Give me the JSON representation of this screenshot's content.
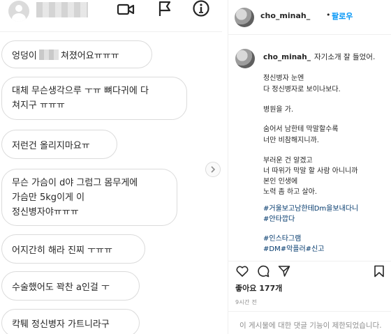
{
  "dm": {
    "header": {
      "icons": [
        "avatar",
        "video-call-icon",
        "flag-icon",
        "info-icon"
      ]
    },
    "messages": [
      {
        "parts": [
          "엉덩이",
          "쳐졌어요ㅠㅠㅠ"
        ]
      },
      {
        "lines": [
          "대체 무슨생각으루 ㅜㅠ 뼈다귀에 다",
          "쳐지구 ㅠㅠㅠ"
        ]
      },
      {
        "lines": [
          "저런건 올리지마요ㅠ"
        ]
      },
      {
        "lines": [
          "무슨 가슴이 d야 그럼그 몸무게에",
          "가슴만 5kg이게 이",
          "정신병자야ㅠㅠㅠ"
        ]
      },
      {
        "lines": [
          "어지간히 해라 진찌 ㅜㅠㅠ"
        ]
      },
      {
        "lines": [
          "수술했어도 꽉찬 a인걸 ㅜ"
        ]
      },
      {
        "lines": [
          "칵퉤 정신병자 가트니라구"
        ]
      }
    ]
  },
  "post": {
    "username": "cho_minah_",
    "follow_separator": "•",
    "follow_label": "팔로우",
    "caption_first": "자기소개 잘 들었어.",
    "caption_lines": [
      "정신병자 눈엔",
      "다 정신병자로 보이나보다.",
      "병원을 가.",
      "숨어서 남한테 막말할수록",
      "너만 비참해지니까.",
      "부러운 건 알겠고",
      "너 따위가 막말 할 사람 아니니까",
      "본인 인생에",
      "노력 좀 하고 살아."
    ],
    "hashtags": [
      "#거울보고남한테Dm을보내다니",
      "#안타깝다",
      "#인스타그램",
      "#DM#악플러#신고"
    ],
    "likes": "좋아요 177개",
    "time_ago": "9시간 전",
    "comments_disabled": "이 게시물에 대한 댓글 기능이 제한되었습니다."
  },
  "colors": {
    "follow_blue": "#0095f6",
    "hashtag": "#00376b",
    "muted": "#8e8e8e",
    "border": "#dbdbdb"
  }
}
